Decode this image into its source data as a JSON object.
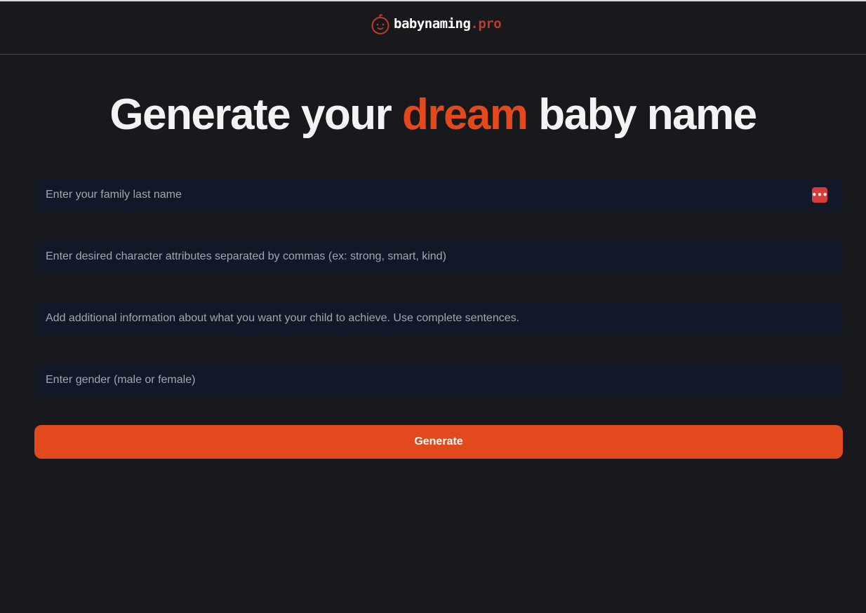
{
  "header": {
    "brand_name": "babynaming",
    "brand_tld": ".pro",
    "logo_icon": "baby-face-icon"
  },
  "hero": {
    "title_before": "Generate your ",
    "title_accent": "dream",
    "title_after": " baby name"
  },
  "form": {
    "last_name": {
      "placeholder": "Enter your family last name",
      "value": ""
    },
    "attributes": {
      "placeholder": "Enter desired character attributes separated by commas (ex: strong, smart, kind)",
      "value": ""
    },
    "additional_info": {
      "placeholder": "Add additional information about what you want your child to achieve. Use complete sentences.",
      "value": ""
    },
    "gender": {
      "placeholder": "Enter gender (male or female)",
      "value": ""
    },
    "password_manager_icon": "password-manager-icon",
    "generate_label": "Generate"
  },
  "colors": {
    "background": "#18191c",
    "accent": "#e24a1d",
    "input_background": "#111827",
    "brand_tld": "#c0392b"
  }
}
